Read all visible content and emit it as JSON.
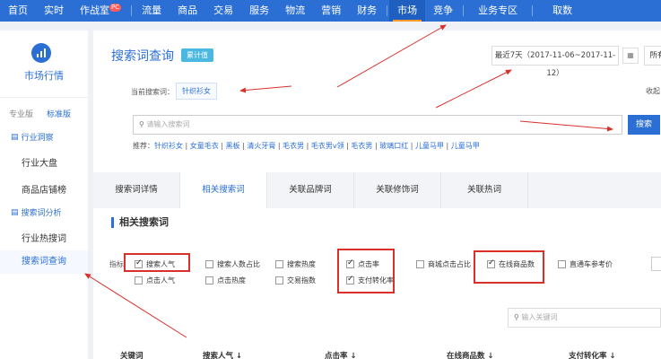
{
  "topnav": {
    "items": [
      "首页",
      "实时",
      "作战室",
      "流量",
      "商品",
      "交易",
      "服务",
      "物流",
      "营销",
      "财务",
      "市场",
      "竞争",
      "业务专区",
      "取数"
    ],
    "badge": "PC",
    "active": "市场"
  },
  "sidebar": {
    "title": "市场行情",
    "editions": [
      "专业版",
      "标准版"
    ],
    "cat1": "行业洞察",
    "cat1_items": [
      "行业大盘",
      "商品店铺榜"
    ],
    "cat2": "搜索词分析",
    "cat2_items": [
      "行业热搜词",
      "搜索词查询"
    ]
  },
  "main": {
    "title": "搜索词查询",
    "tag": "累计值",
    "daterange": "最近7天（2017-11-06~2017-11-12）",
    "all_label": "所有",
    "current_label": "当前搜索词：",
    "current_term": "针织衫女",
    "collect_label": "收起",
    "search_placeholder": "请输入搜索词",
    "search_button": "搜索",
    "recommend_label": "推荐：",
    "recommend_items": [
      "针织衫女",
      "女童毛衣",
      "黑板",
      "清火牙膏",
      "毛衣男",
      "毛衣男v领",
      "毛衣男",
      "玻璃口红",
      "儿童马甲",
      "儿童马甲"
    ],
    "tabs": [
      "搜索词详情",
      "相关搜索词",
      "关联品牌词",
      "关联修饰词",
      "关联热词"
    ],
    "section_title": "相关搜索词",
    "index_label": "指标",
    "options": [
      {
        "label": "搜索人气",
        "checked": true
      },
      {
        "label": "搜索人数占比",
        "checked": false
      },
      {
        "label": "搜索热度",
        "checked": false
      },
      {
        "label": "点击率",
        "checked": true
      },
      {
        "label": "商城点击占比",
        "checked": false
      },
      {
        "label": "在线商品数",
        "checked": true
      },
      {
        "label": "直通车参考价",
        "checked": false
      },
      {
        "label": "点击人气",
        "checked": false
      },
      {
        "label": "点击热度",
        "checked": false
      },
      {
        "label": "交易指数",
        "checked": false
      },
      {
        "label": "支付转化率",
        "checked": true
      }
    ],
    "keyword_search_placeholder": "输入关键词",
    "table_headers": [
      "关键词",
      "搜索人气 ↓",
      "点击率 ↓",
      "在线商品数 ↓",
      "支付转化率 ↓"
    ]
  }
}
